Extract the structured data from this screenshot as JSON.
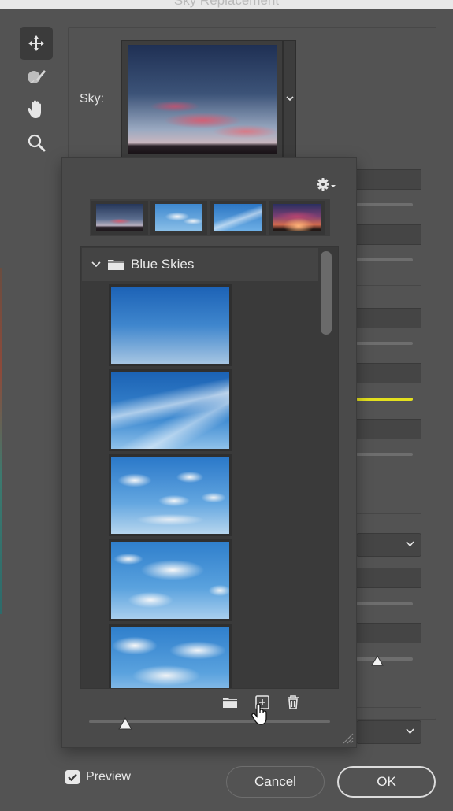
{
  "window": {
    "title": "Sky Replacement"
  },
  "tools": [
    {
      "name": "move-tool-icon",
      "active": true
    },
    {
      "name": "sky-brush-icon",
      "active": false
    },
    {
      "name": "hand-tool-icon",
      "active": false
    },
    {
      "name": "zoom-tool-icon",
      "active": false
    }
  ],
  "sky": {
    "label": "Sky:"
  },
  "presets": {
    "group_name": "Blue Skies",
    "recent": [
      "Sunset sky",
      "Cloudy blue sky",
      "Wispy blue sky",
      "Spectacular sunset"
    ],
    "tiles": [
      "Clear blue gradient",
      "Wispy cirrus",
      "Scattered cumulus",
      "Puffy cumulus",
      "Dense cumulus"
    ],
    "size_slider_value": 0.16
  },
  "preview": {
    "label": "Preview",
    "checked": true
  },
  "buttons": {
    "cancel": "Cancel",
    "ok": "OK"
  },
  "colors": {
    "accent_yellow": "#e3e01e",
    "panel_bg": "#535353",
    "popup_bg": "#4a4a4a"
  }
}
